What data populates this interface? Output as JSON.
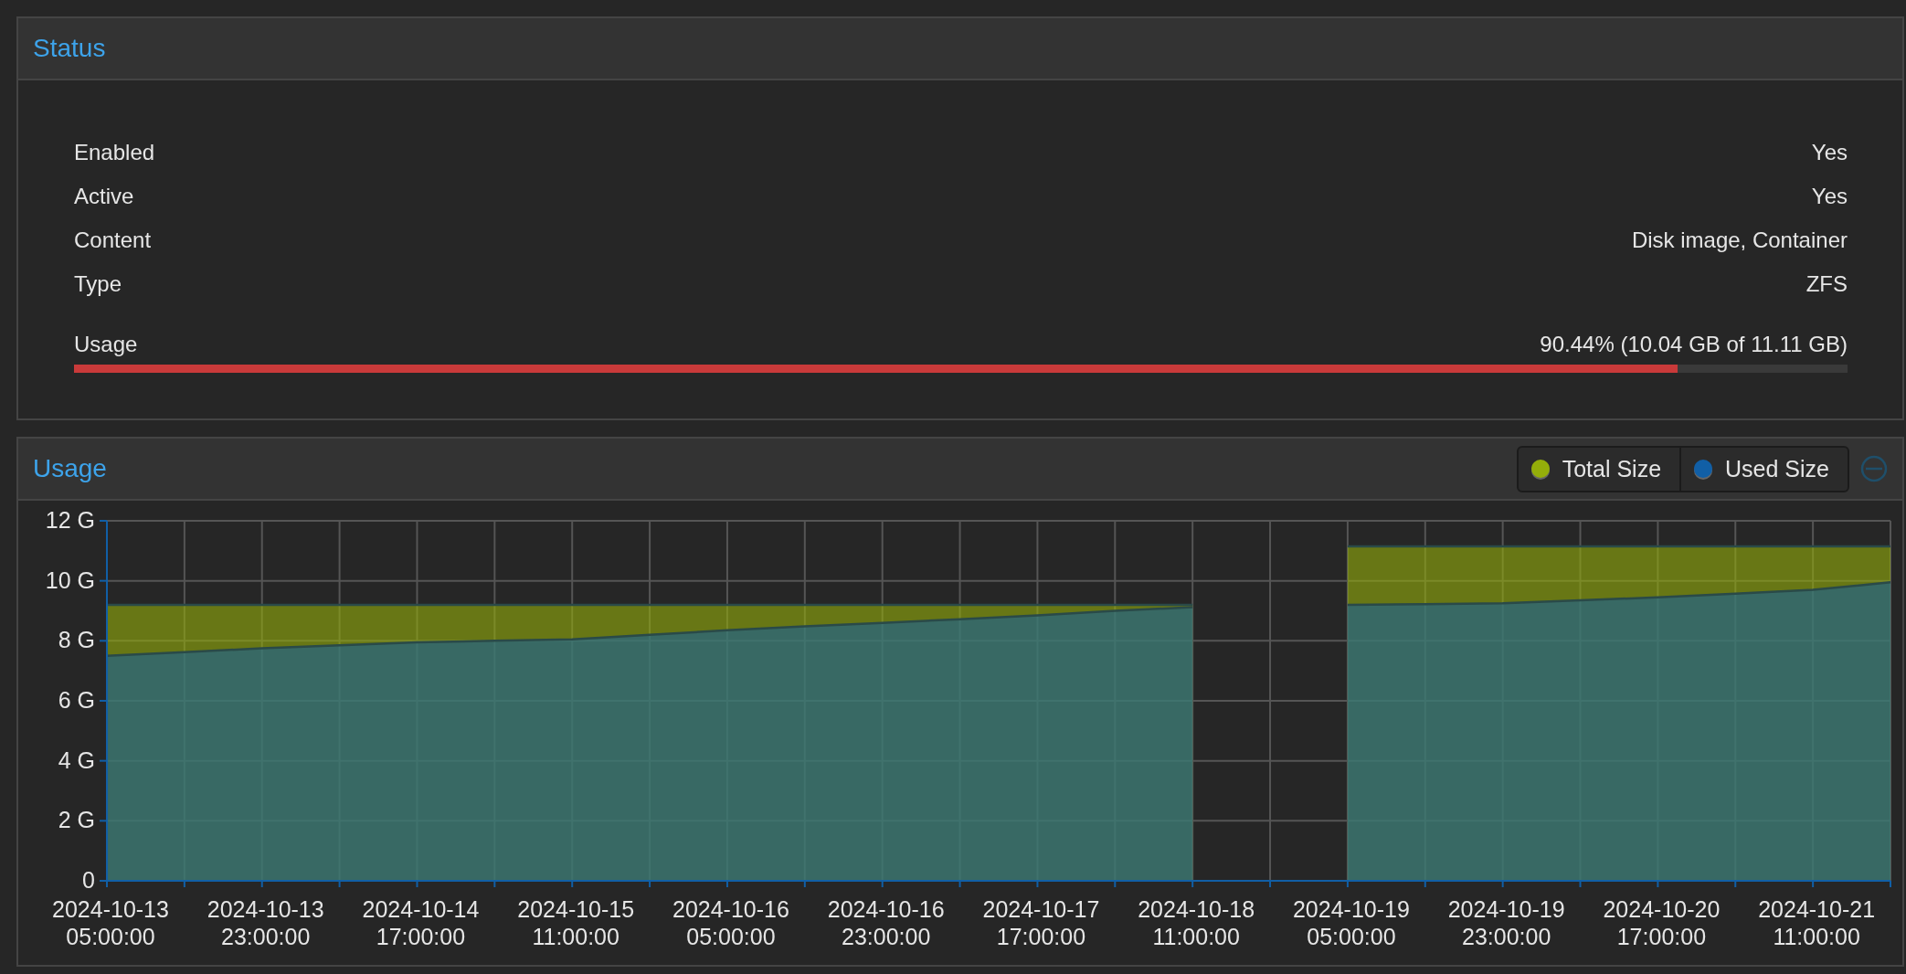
{
  "status_panel": {
    "title": "Status",
    "rows": [
      {
        "label": "Enabled",
        "value": "Yes"
      },
      {
        "label": "Active",
        "value": "Yes"
      },
      {
        "label": "Content",
        "value": "Disk image, Container"
      },
      {
        "label": "Type",
        "value": "ZFS"
      }
    ],
    "usage": {
      "label": "Usage",
      "reading": "90.44% (10.04 GB of 11.11 GB)",
      "level": 0.9044
    }
  },
  "usage_panel": {
    "title": "Usage",
    "chart_data": {
      "type": "area",
      "stacked": false,
      "grid": true,
      "categories": [
        "2024-10-13 05:00:00",
        null,
        "2024-10-13 23:00:00",
        null,
        "2024-10-14 17:00:00",
        null,
        "2024-10-15 11:00:00",
        null,
        "2024-10-16 05:00:00",
        null,
        "2024-10-16 23:00:00",
        null,
        "2024-10-17 17:00:00",
        null,
        "2024-10-18 11:00:00",
        null,
        "2024-10-19 05:00:00",
        null,
        "2024-10-19 23:00:00",
        null,
        "2024-10-20 17:00:00",
        null,
        "2024-10-21 11:00:00",
        null
      ],
      "series": [
        {
          "name": "Total Size",
          "color": "#94ae0a",
          "values": [
            9.2,
            9.2,
            9.2,
            9.2,
            9.2,
            9.2,
            9.2,
            9.2,
            9.2,
            9.2,
            9.2,
            9.2,
            9.2,
            9.2,
            9.2,
            null,
            11.15,
            11.15,
            11.15,
            11.15,
            11.15,
            11.15,
            11.15,
            11.15
          ]
        },
        {
          "name": "Used Size",
          "color": "#115fa6",
          "values": [
            7.5,
            7.62,
            7.75,
            7.85,
            7.95,
            8.0,
            8.05,
            8.2,
            8.35,
            8.48,
            8.6,
            8.72,
            8.85,
            9.0,
            9.12,
            null,
            9.2,
            9.22,
            9.25,
            9.35,
            9.45,
            9.57,
            9.7,
            9.95
          ]
        }
      ],
      "ylim": [
        0,
        12
      ],
      "yticks": [
        {
          "value": 0,
          "label": "0"
        },
        {
          "value": 2,
          "label": "2 G"
        },
        {
          "value": 4,
          "label": "4 G"
        },
        {
          "value": 6,
          "label": "6 G"
        },
        {
          "value": 8,
          "label": "8 G"
        },
        {
          "value": 10,
          "label": "10 G"
        },
        {
          "value": 12,
          "label": "12 G"
        }
      ]
    }
  }
}
